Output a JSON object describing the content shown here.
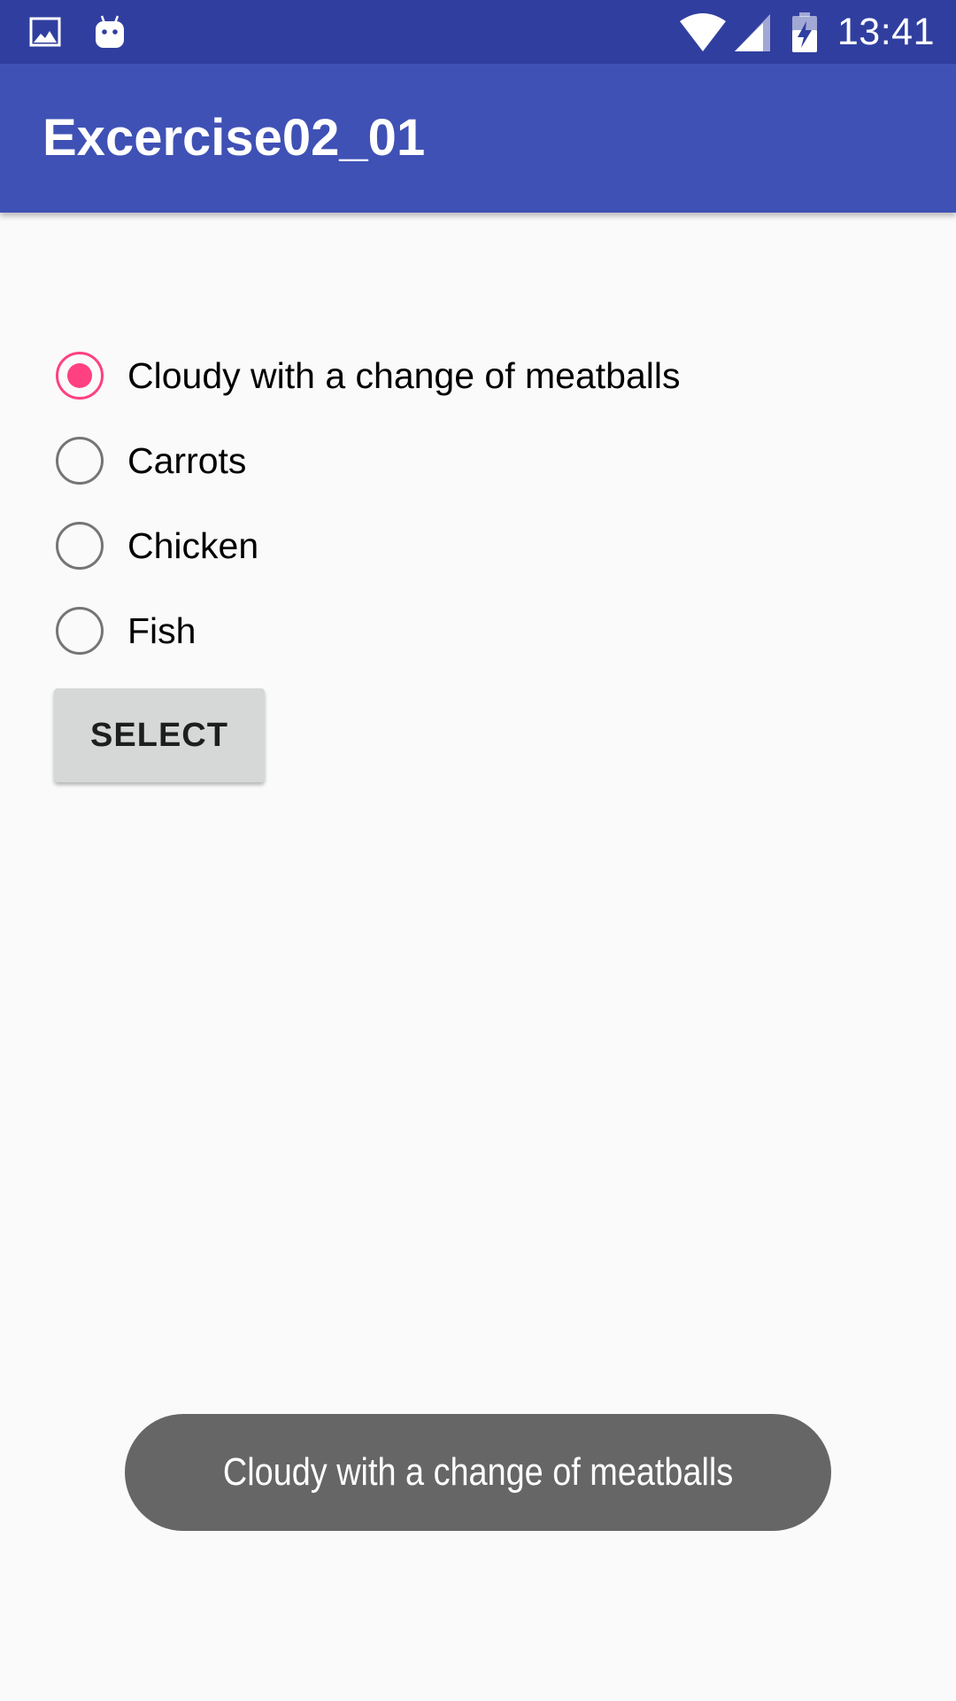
{
  "status_bar": {
    "time": "13:41",
    "left_icons": [
      "gallery-notification-icon",
      "android-debug-notification-icon"
    ],
    "right_icons": [
      "wifi-icon",
      "cell-signal-icon",
      "battery-charging-icon"
    ],
    "background_color": "#303f9f"
  },
  "app_bar": {
    "title": "Excercise02_01",
    "background_color": "#3f51b5"
  },
  "radio_group": {
    "selected_index": 0,
    "accent_color": "#ff4081",
    "options": [
      {
        "label": "Cloudy with a change of meatballs",
        "checked": true
      },
      {
        "label": "Carrots",
        "checked": false
      },
      {
        "label": "Chicken",
        "checked": false
      },
      {
        "label": "Fish",
        "checked": false
      }
    ]
  },
  "select_button": {
    "label": "SELECT"
  },
  "toast": {
    "message": "Cloudy with a change of meatballs"
  }
}
